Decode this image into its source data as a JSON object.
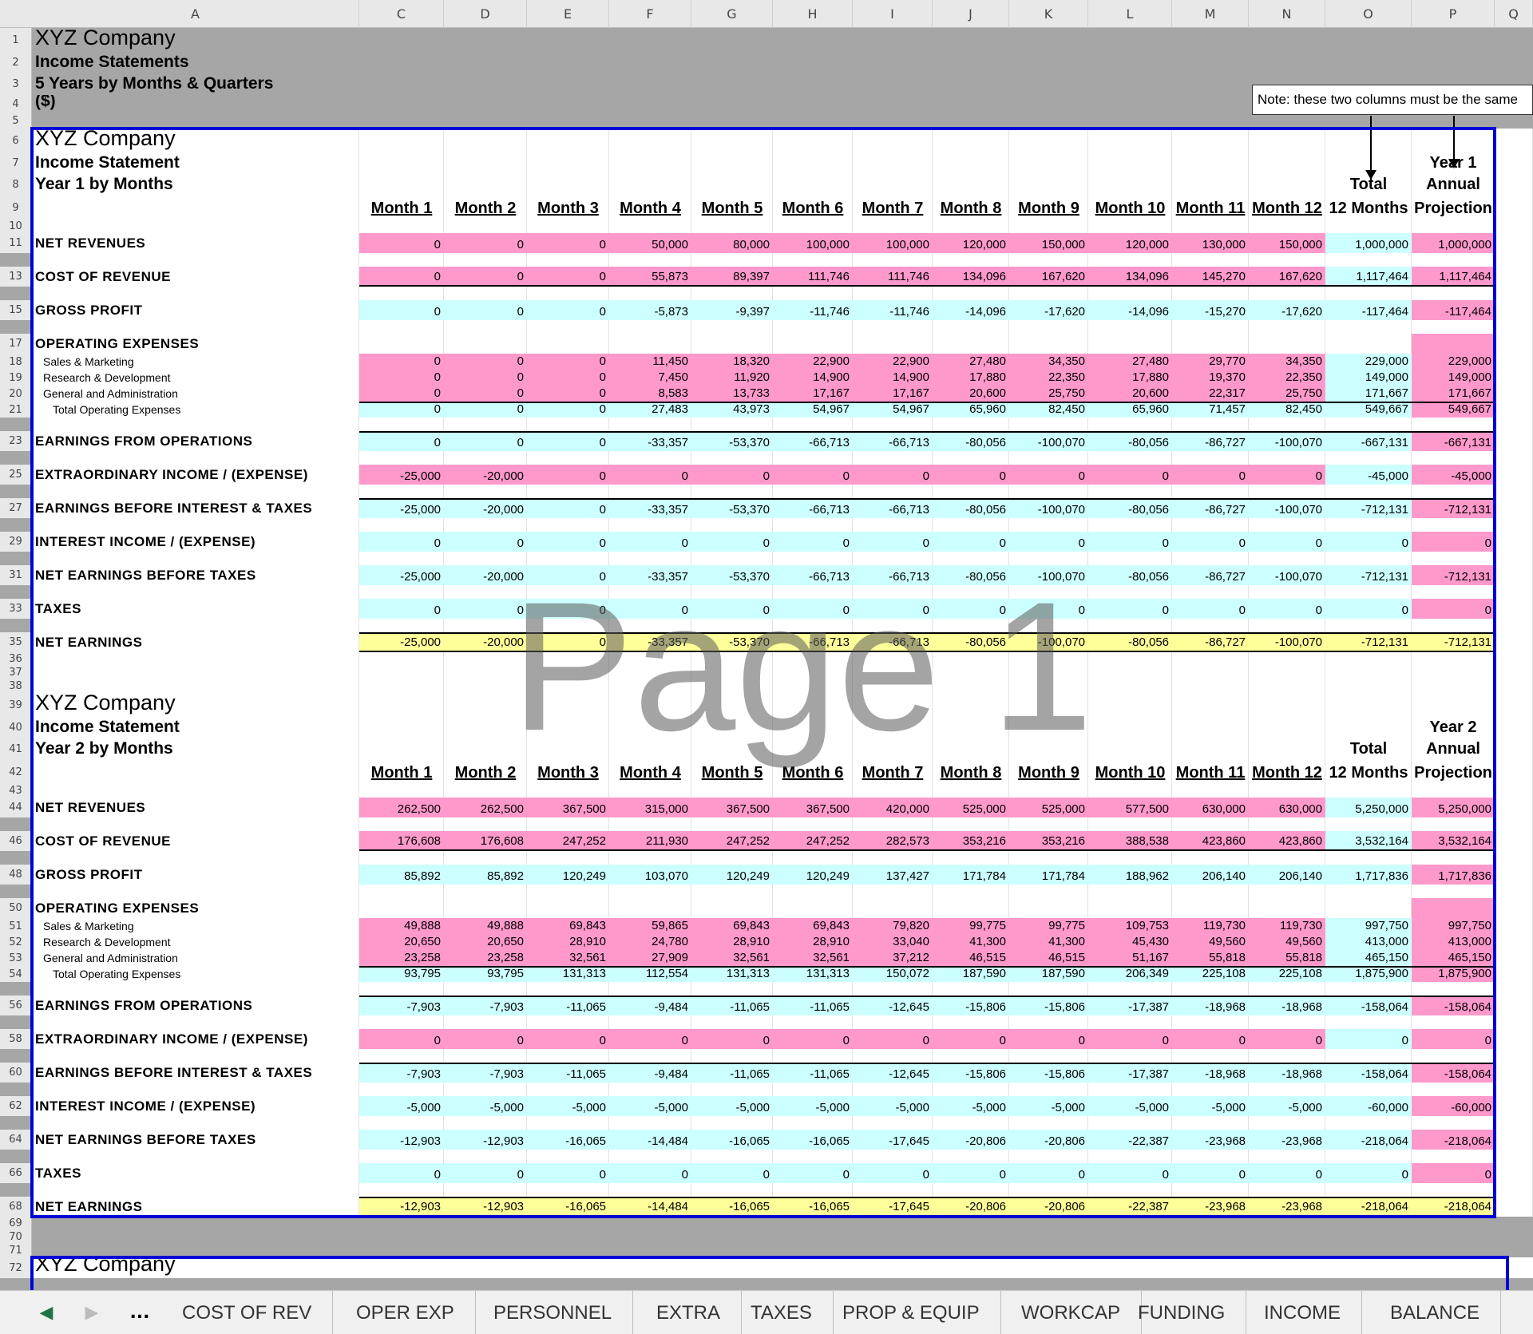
{
  "columns": [
    "A",
    "C",
    "D",
    "E",
    "F",
    "G",
    "H",
    "I",
    "J",
    "K",
    "L",
    "M",
    "N",
    "O",
    "P",
    "Q"
  ],
  "header": {
    "company": "XYZ Company",
    "subtitle": "Income Statements",
    "period": "5 Years by Months & Quarters",
    "units": "($)"
  },
  "note": "Note: these two columns must be the same",
  "watermark": "Page 1",
  "colors": {
    "pink": "#ff99cc",
    "cyan": "#ccffff",
    "yellow": "#ffff99",
    "blue_border": "#0000d6"
  },
  "year1": {
    "company": "XYZ Company",
    "title": "Income Statement",
    "period": "Year 1 by Months",
    "total_top": "Total",
    "total_bottom": "12 Months",
    "annual_top": "Year 1",
    "annual_mid": "Annual",
    "annual_bottom": "Projection",
    "months": [
      "Month 1",
      "Month 2",
      "Month 3",
      "Month 4",
      "Month 5",
      "Month 6",
      "Month 7",
      "Month 8",
      "Month 9",
      "Month 10",
      "Month 11",
      "Month 12"
    ],
    "lines": [
      {
        "label": "NET REVENUES",
        "style": "lbl",
        "fill": "pink",
        "tot_fill": "cyan",
        "values": [
          "0",
          "0",
          "0",
          "50,000",
          "80,000",
          "100,000",
          "100,000",
          "120,000",
          "150,000",
          "120,000",
          "130,000",
          "150,000",
          "1,000,000",
          "1,000,000"
        ]
      },
      {
        "label": "COST OF REVENUE",
        "style": "lbl",
        "fill": "pink",
        "tot_fill": "cyan",
        "values": [
          "0",
          "0",
          "0",
          "55,873",
          "89,397",
          "111,746",
          "111,746",
          "134,096",
          "167,620",
          "134,096",
          "145,270",
          "167,620",
          "1,117,464",
          "1,117,464"
        ]
      },
      {
        "label": "GROSS PROFIT",
        "style": "lbl",
        "fill": "cyan",
        "tot_fill": "cyan",
        "values": [
          "0",
          "0",
          "0",
          "-5,873",
          "-9,397",
          "-11,746",
          "-11,746",
          "-14,096",
          "-17,620",
          "-14,096",
          "-15,270",
          "-17,620",
          "-117,464",
          "-117,464"
        ]
      },
      {
        "label": "OPERATING EXPENSES",
        "style": "lbl",
        "fill": "none",
        "tot_fill": "none",
        "values": []
      },
      {
        "label": "Sales & Marketing",
        "style": "sub",
        "fill": "pink",
        "tot_fill": "cyan",
        "values": [
          "0",
          "0",
          "0",
          "11,450",
          "18,320",
          "22,900",
          "22,900",
          "27,480",
          "34,350",
          "27,480",
          "29,770",
          "34,350",
          "229,000",
          "229,000"
        ]
      },
      {
        "label": "Research & Development",
        "style": "sub",
        "fill": "pink",
        "tot_fill": "cyan",
        "values": [
          "0",
          "0",
          "0",
          "7,450",
          "11,920",
          "14,900",
          "14,900",
          "17,880",
          "22,350",
          "17,880",
          "19,370",
          "22,350",
          "149,000",
          "149,000"
        ]
      },
      {
        "label": "General and Administration",
        "style": "sub",
        "fill": "pink",
        "tot_fill": "cyan",
        "values": [
          "0",
          "0",
          "0",
          "8,583",
          "13,733",
          "17,167",
          "17,167",
          "20,600",
          "25,750",
          "20,600",
          "22,317",
          "25,750",
          "171,667",
          "171,667"
        ]
      },
      {
        "label": "Total Operating Expenses",
        "style": "sub2",
        "fill": "cyan",
        "tot_fill": "cyan",
        "values": [
          "0",
          "0",
          "0",
          "27,483",
          "43,973",
          "54,967",
          "54,967",
          "65,960",
          "82,450",
          "65,960",
          "71,457",
          "82,450",
          "549,667",
          "549,667"
        ]
      },
      {
        "label": "EARNINGS FROM OPERATIONS",
        "style": "lbl",
        "fill": "cyan",
        "tot_fill": "cyan",
        "values": [
          "0",
          "0",
          "0",
          "-33,357",
          "-53,370",
          "-66,713",
          "-66,713",
          "-80,056",
          "-100,070",
          "-80,056",
          "-86,727",
          "-100,070",
          "-667,131",
          "-667,131"
        ]
      },
      {
        "label": "EXTRAORDINARY INCOME / (EXPENSE)",
        "style": "lbl",
        "fill": "pink",
        "tot_fill": "cyan",
        "values": [
          "-25,000",
          "-20,000",
          "0",
          "0",
          "0",
          "0",
          "0",
          "0",
          "0",
          "0",
          "0",
          "0",
          "-45,000",
          "-45,000"
        ]
      },
      {
        "label": "EARNINGS BEFORE INTEREST & TAXES",
        "style": "lbl",
        "fill": "cyan",
        "tot_fill": "cyan",
        "values": [
          "-25,000",
          "-20,000",
          "0",
          "-33,357",
          "-53,370",
          "-66,713",
          "-66,713",
          "-80,056",
          "-100,070",
          "-80,056",
          "-86,727",
          "-100,070",
          "-712,131",
          "-712,131"
        ]
      },
      {
        "label": "INTEREST INCOME / (EXPENSE)",
        "style": "lbl",
        "fill": "cyan",
        "tot_fill": "cyan",
        "values": [
          "0",
          "0",
          "0",
          "0",
          "0",
          "0",
          "0",
          "0",
          "0",
          "0",
          "0",
          "0",
          "0",
          "0"
        ]
      },
      {
        "label": "NET EARNINGS BEFORE TAXES",
        "style": "lbl",
        "fill": "cyan",
        "tot_fill": "cyan",
        "values": [
          "-25,000",
          "-20,000",
          "0",
          "-33,357",
          "-53,370",
          "-66,713",
          "-66,713",
          "-80,056",
          "-100,070",
          "-80,056",
          "-86,727",
          "-100,070",
          "-712,131",
          "-712,131"
        ]
      },
      {
        "label": "TAXES",
        "style": "lbl",
        "fill": "cyan",
        "tot_fill": "cyan",
        "values": [
          "0",
          "0",
          "0",
          "0",
          "0",
          "0",
          "0",
          "0",
          "0",
          "0",
          "0",
          "0",
          "0",
          "0"
        ]
      },
      {
        "label": "NET EARNINGS",
        "style": "lbl",
        "fill": "yellow",
        "tot_fill": "yellow",
        "values": [
          "-25,000",
          "-20,000",
          "0",
          "-33,357",
          "-53,370",
          "-66,713",
          "-66,713",
          "-80,056",
          "-100,070",
          "-80,056",
          "-86,727",
          "-100,070",
          "-712,131",
          "-712,131"
        ]
      }
    ]
  },
  "year2": {
    "company": "XYZ Company",
    "title": "Income Statement",
    "period": "Year 2 by Months",
    "total_top": "Total",
    "total_bottom": "12 Months",
    "annual_top": "Year 2",
    "annual_mid": "Annual",
    "annual_bottom": "Projection",
    "months": [
      "Month 1",
      "Month 2",
      "Month 3",
      "Month 4",
      "Month 5",
      "Month 6",
      "Month 7",
      "Month 8",
      "Month 9",
      "Month 10",
      "Month 11",
      "Month 12"
    ],
    "lines": [
      {
        "label": "NET REVENUES",
        "style": "lbl",
        "fill": "pink",
        "tot_fill": "cyan",
        "values": [
          "262,500",
          "262,500",
          "367,500",
          "315,000",
          "367,500",
          "367,500",
          "420,000",
          "525,000",
          "525,000",
          "577,500",
          "630,000",
          "630,000",
          "5,250,000",
          "5,250,000"
        ]
      },
      {
        "label": "COST OF REVENUE",
        "style": "lbl",
        "fill": "pink",
        "tot_fill": "cyan",
        "values": [
          "176,608",
          "176,608",
          "247,252",
          "211,930",
          "247,252",
          "247,252",
          "282,573",
          "353,216",
          "353,216",
          "388,538",
          "423,860",
          "423,860",
          "3,532,164",
          "3,532,164"
        ]
      },
      {
        "label": "GROSS PROFIT",
        "style": "lbl",
        "fill": "cyan",
        "tot_fill": "cyan",
        "values": [
          "85,892",
          "85,892",
          "120,249",
          "103,070",
          "120,249",
          "120,249",
          "137,427",
          "171,784",
          "171,784",
          "188,962",
          "206,140",
          "206,140",
          "1,717,836",
          "1,717,836"
        ]
      },
      {
        "label": "OPERATING EXPENSES",
        "style": "lbl",
        "fill": "none",
        "tot_fill": "none",
        "values": []
      },
      {
        "label": "Sales & Marketing",
        "style": "sub",
        "fill": "pink",
        "tot_fill": "cyan",
        "values": [
          "49,888",
          "49,888",
          "69,843",
          "59,865",
          "69,843",
          "69,843",
          "79,820",
          "99,775",
          "99,775",
          "109,753",
          "119,730",
          "119,730",
          "997,750",
          "997,750"
        ]
      },
      {
        "label": "Research & Development",
        "style": "sub",
        "fill": "pink",
        "tot_fill": "cyan",
        "values": [
          "20,650",
          "20,650",
          "28,910",
          "24,780",
          "28,910",
          "28,910",
          "33,040",
          "41,300",
          "41,300",
          "45,430",
          "49,560",
          "49,560",
          "413,000",
          "413,000"
        ]
      },
      {
        "label": "General and Administration",
        "style": "sub",
        "fill": "pink",
        "tot_fill": "cyan",
        "values": [
          "23,258",
          "23,258",
          "32,561",
          "27,909",
          "32,561",
          "32,561",
          "37,212",
          "46,515",
          "46,515",
          "51,167",
          "55,818",
          "55,818",
          "465,150",
          "465,150"
        ]
      },
      {
        "label": "Total Operating Expenses",
        "style": "sub2",
        "fill": "cyan",
        "tot_fill": "cyan",
        "values": [
          "93,795",
          "93,795",
          "131,313",
          "112,554",
          "131,313",
          "131,313",
          "150,072",
          "187,590",
          "187,590",
          "206,349",
          "225,108",
          "225,108",
          "1,875,900",
          "1,875,900"
        ]
      },
      {
        "label": "EARNINGS FROM OPERATIONS",
        "style": "lbl",
        "fill": "cyan",
        "tot_fill": "cyan",
        "values": [
          "-7,903",
          "-7,903",
          "-11,065",
          "-9,484",
          "-11,065",
          "-11,065",
          "-12,645",
          "-15,806",
          "-15,806",
          "-17,387",
          "-18,968",
          "-18,968",
          "-158,064",
          "-158,064"
        ]
      },
      {
        "label": "EXTRAORDINARY INCOME / (EXPENSE)",
        "style": "lbl",
        "fill": "pink",
        "tot_fill": "cyan",
        "values": [
          "0",
          "0",
          "0",
          "0",
          "0",
          "0",
          "0",
          "0",
          "0",
          "0",
          "0",
          "0",
          "0",
          "0"
        ]
      },
      {
        "label": "EARNINGS BEFORE INTEREST & TAXES",
        "style": "lbl",
        "fill": "cyan",
        "tot_fill": "cyan",
        "values": [
          "-7,903",
          "-7,903",
          "-11,065",
          "-9,484",
          "-11,065",
          "-11,065",
          "-12,645",
          "-15,806",
          "-15,806",
          "-17,387",
          "-18,968",
          "-18,968",
          "-158,064",
          "-158,064"
        ]
      },
      {
        "label": "INTEREST INCOME / (EXPENSE)",
        "style": "lbl",
        "fill": "cyan",
        "tot_fill": "cyan",
        "values": [
          "-5,000",
          "-5,000",
          "-5,000",
          "-5,000",
          "-5,000",
          "-5,000",
          "-5,000",
          "-5,000",
          "-5,000",
          "-5,000",
          "-5,000",
          "-5,000",
          "-60,000",
          "-60,000"
        ]
      },
      {
        "label": "NET EARNINGS BEFORE TAXES",
        "style": "lbl",
        "fill": "cyan",
        "tot_fill": "cyan",
        "values": [
          "-12,903",
          "-12,903",
          "-16,065",
          "-14,484",
          "-16,065",
          "-16,065",
          "-17,645",
          "-20,806",
          "-20,806",
          "-22,387",
          "-23,968",
          "-23,968",
          "-218,064",
          "-218,064"
        ]
      },
      {
        "label": "TAXES",
        "style": "lbl",
        "fill": "cyan",
        "tot_fill": "cyan",
        "values": [
          "0",
          "0",
          "0",
          "0",
          "0",
          "0",
          "0",
          "0",
          "0",
          "0",
          "0",
          "0",
          "0",
          "0"
        ]
      },
      {
        "label": "NET EARNINGS",
        "style": "lbl",
        "fill": "yellow",
        "tot_fill": "yellow",
        "values": [
          "-12,903",
          "-12,903",
          "-16,065",
          "-14,484",
          "-16,065",
          "-16,065",
          "-17,645",
          "-20,806",
          "-20,806",
          "-22,387",
          "-23,968",
          "-23,968",
          "-218,064",
          "-218,064"
        ]
      }
    ]
  },
  "year3_company": "XYZ Company",
  "tabs": {
    "ellipsis": "...",
    "sheets": [
      "COST OF REV",
      "OPER EXP",
      "PERSONNEL",
      "EXTRA",
      "TAXES",
      "PROP & EQUIP",
      "WORKCAP",
      "FUNDING",
      "INCOME",
      "BALANCE"
    ]
  }
}
